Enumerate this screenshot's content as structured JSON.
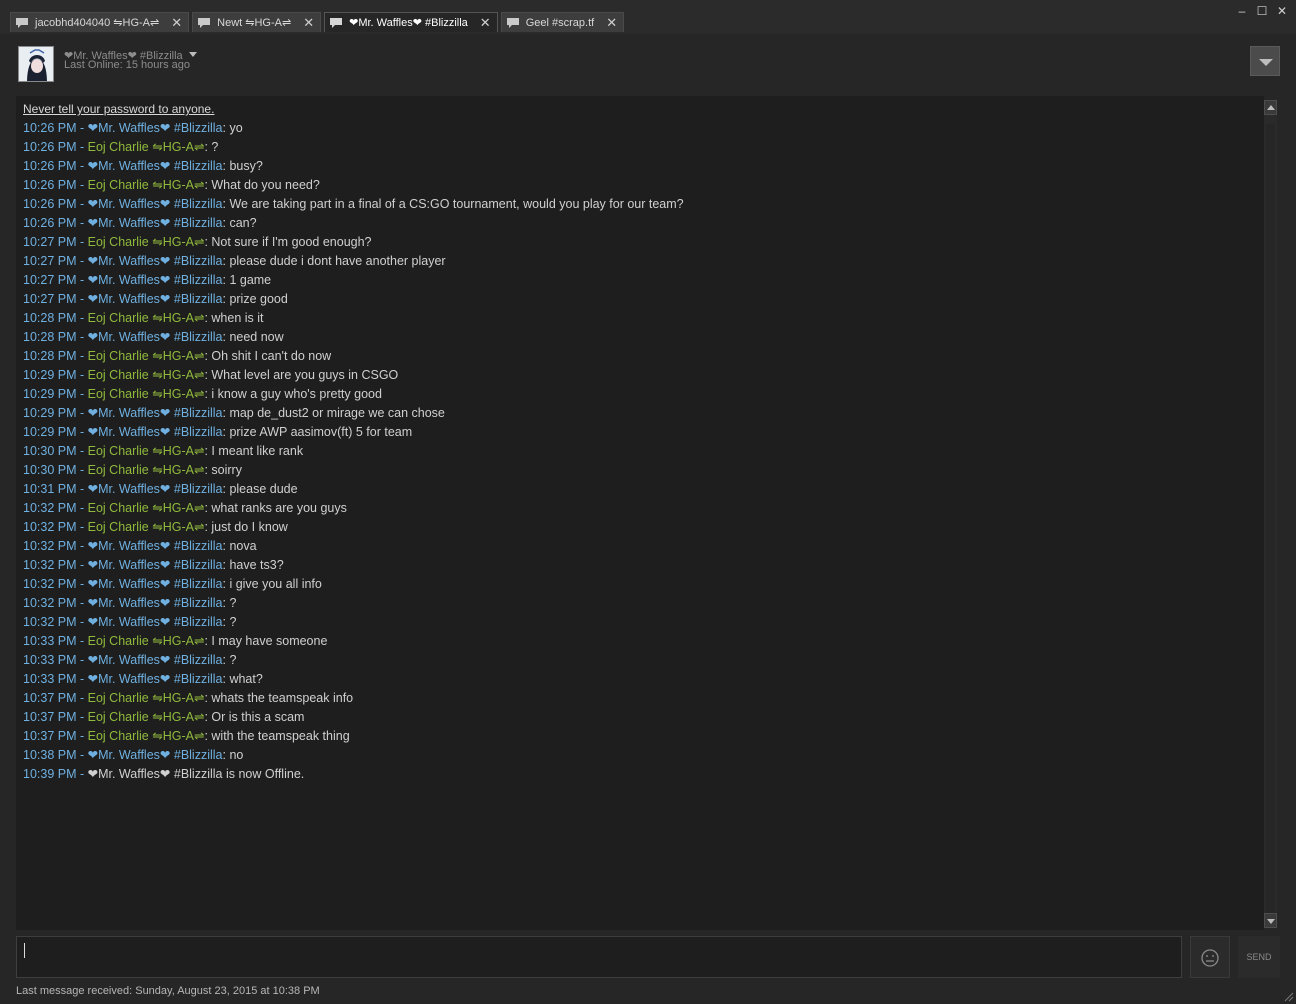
{
  "tabs": [
    {
      "label": "jacobhd404040 ⇋HG-A⇌"
    },
    {
      "label": "Newt ⇋HG-A⇌"
    },
    {
      "label": "❤Mr. Waffles❤ #Blizzilla"
    },
    {
      "label": "Geel #scrap.tf"
    }
  ],
  "window_controls": {
    "minimize": "–",
    "maximize": "☐",
    "close": "✕"
  },
  "header": {
    "username": "❤Mr. Waffles❤ #Blizzilla",
    "status": "Last Online: 15 hours ago"
  },
  "chat": {
    "warning": "Never tell your password to anyone.",
    "messages": [
      {
        "time": "10:26 PM - ",
        "sender": "❤Mr. Waffles❤ #Blizzilla",
        "color": "blue",
        "text": ": yo"
      },
      {
        "time": "10:26 PM - ",
        "sender": "Eoj Charlie ⇋HG-A⇌",
        "color": "green",
        "text": ": ?"
      },
      {
        "time": "10:26 PM - ",
        "sender": "❤Mr. Waffles❤ #Blizzilla",
        "color": "blue",
        "text": ": busy?"
      },
      {
        "time": "10:26 PM - ",
        "sender": "Eoj Charlie ⇋HG-A⇌",
        "color": "green",
        "text": ": What do you need?"
      },
      {
        "time": "10:26 PM - ",
        "sender": "❤Mr. Waffles❤ #Blizzilla",
        "color": "blue",
        "text": ": We are taking part in a final of a CS:GO tournament, would you play for our team?"
      },
      {
        "time": "10:26 PM - ",
        "sender": "❤Mr. Waffles❤ #Blizzilla",
        "color": "blue",
        "text": ": can?"
      },
      {
        "time": "10:27 PM - ",
        "sender": "Eoj Charlie ⇋HG-A⇌",
        "color": "green",
        "text": ": Not sure if I'm good enough?"
      },
      {
        "time": "10:27 PM - ",
        "sender": "❤Mr. Waffles❤ #Blizzilla",
        "color": "blue",
        "text": ": please dude i dont have another player"
      },
      {
        "time": "10:27 PM - ",
        "sender": "❤Mr. Waffles❤ #Blizzilla",
        "color": "blue",
        "text": ": 1 game"
      },
      {
        "time": "10:27 PM - ",
        "sender": "❤Mr. Waffles❤ #Blizzilla",
        "color": "blue",
        "text": ": prize good"
      },
      {
        "time": "10:28 PM - ",
        "sender": "Eoj Charlie ⇋HG-A⇌",
        "color": "green",
        "text": ": when is it"
      },
      {
        "time": "10:28 PM - ",
        "sender": "❤Mr. Waffles❤ #Blizzilla",
        "color": "blue",
        "text": ": need now"
      },
      {
        "time": "10:28 PM - ",
        "sender": "Eoj Charlie ⇋HG-A⇌",
        "color": "green",
        "text": ": Oh shit I can't do now"
      },
      {
        "time": "10:29 PM - ",
        "sender": "Eoj Charlie ⇋HG-A⇌",
        "color": "green",
        "text": ": What level are you guys in CSGO"
      },
      {
        "time": "10:29 PM - ",
        "sender": "Eoj Charlie ⇋HG-A⇌",
        "color": "green",
        "text": ": i know a guy who's pretty good"
      },
      {
        "time": "10:29 PM - ",
        "sender": "❤Mr. Waffles❤ #Blizzilla",
        "color": "blue",
        "text": ": map de_dust2 or mirage we can chose"
      },
      {
        "time": "10:29 PM - ",
        "sender": "❤Mr. Waffles❤ #Blizzilla",
        "color": "blue",
        "text": ": prize AWP aasimov(ft) 5 for team"
      },
      {
        "time": "10:30 PM - ",
        "sender": "Eoj Charlie ⇋HG-A⇌",
        "color": "green",
        "text": ": I meant like rank"
      },
      {
        "time": "10:30 PM - ",
        "sender": "Eoj Charlie ⇋HG-A⇌",
        "color": "green",
        "text": ": soirry"
      },
      {
        "time": "10:31 PM - ",
        "sender": "❤Mr. Waffles❤ #Blizzilla",
        "color": "blue",
        "text": ": please dude"
      },
      {
        "time": "10:32 PM - ",
        "sender": "Eoj Charlie ⇋HG-A⇌",
        "color": "green",
        "text": ": what ranks are you guys"
      },
      {
        "time": "10:32 PM - ",
        "sender": "Eoj Charlie ⇋HG-A⇌",
        "color": "green",
        "text": ": just do I know"
      },
      {
        "time": "10:32 PM - ",
        "sender": "❤Mr. Waffles❤ #Blizzilla",
        "color": "blue",
        "text": ": nova"
      },
      {
        "time": "10:32 PM - ",
        "sender": "❤Mr. Waffles❤ #Blizzilla",
        "color": "blue",
        "text": ": have ts3?"
      },
      {
        "time": "10:32 PM - ",
        "sender": "❤Mr. Waffles❤ #Blizzilla",
        "color": "blue",
        "text": ": i give you all info"
      },
      {
        "time": "10:32 PM - ",
        "sender": "❤Mr. Waffles❤ #Blizzilla",
        "color": "blue",
        "text": ": ?"
      },
      {
        "time": "10:32 PM - ",
        "sender": "❤Mr. Waffles❤ #Blizzilla",
        "color": "blue",
        "text": ": ?"
      },
      {
        "time": "10:33 PM - ",
        "sender": "Eoj Charlie ⇋HG-A⇌",
        "color": "green",
        "text": ": I may have someone"
      },
      {
        "time": "10:33 PM - ",
        "sender": "❤Mr. Waffles❤ #Blizzilla",
        "color": "blue",
        "text": ": ?"
      },
      {
        "time": "10:33 PM - ",
        "sender": "❤Mr. Waffles❤ #Blizzilla",
        "color": "blue",
        "text": ": what?"
      },
      {
        "time": "10:37 PM - ",
        "sender": "Eoj Charlie ⇋HG-A⇌",
        "color": "green",
        "text": ": whats the teamspeak info"
      },
      {
        "time": "10:37 PM - ",
        "sender": "Eoj Charlie ⇋HG-A⇌",
        "color": "green",
        "text": ": Or is this a scam"
      },
      {
        "time": "10:37 PM - ",
        "sender": "Eoj Charlie ⇋HG-A⇌",
        "color": "green",
        "text": ": with the teamspeak thing"
      },
      {
        "time": "10:38 PM - ",
        "sender": "❤Mr. Waffles❤ #Blizzilla",
        "color": "blue",
        "text": ": no"
      },
      {
        "time": "10:39 PM - ",
        "sender": "",
        "color": "offline",
        "text": "❤Mr. Waffles❤ #Blizzilla is now Offline."
      }
    ]
  },
  "composer": {
    "value": "",
    "send_label": "SEND"
  },
  "footer": {
    "last_message": "Last message received: Sunday, August 23, 2015 at 10:38 PM"
  },
  "colors": {
    "time": "#6fb0e0",
    "blue": "#6fb0e0",
    "green": "#90ba3c",
    "text": "#d0d0d0"
  },
  "icons": {
    "tab": "chat-bubble-icon",
    "emoji": "emoticon-icon",
    "menu": "chevron-down-icon"
  }
}
